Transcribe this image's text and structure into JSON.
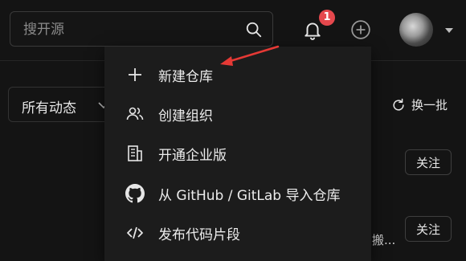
{
  "search": {
    "placeholder": "搜开源",
    "value": ""
  },
  "notifications": {
    "badge_count": "1"
  },
  "filter": {
    "label": "所有动态"
  },
  "refresh": {
    "label": "换一批"
  },
  "feed": {
    "follow_label_1": "关注",
    "follow_label_2": "关注",
    "truncated_text": "搬..."
  },
  "dropdown": {
    "items": [
      {
        "label": "新建仓库",
        "icon": "plus-icon"
      },
      {
        "label": "创建组织",
        "icon": "people-icon"
      },
      {
        "label": "开通企业版",
        "icon": "building-icon"
      },
      {
        "label": "从 GitHub / GitLab 导入仓库",
        "icon": "github-icon"
      },
      {
        "label": "发布代码片段",
        "icon": "code-icon"
      }
    ]
  },
  "colors": {
    "badge": "#e5484d",
    "annotation_arrow": "#e53935",
    "background": "#141414",
    "menu_background": "#1c1c1c"
  }
}
